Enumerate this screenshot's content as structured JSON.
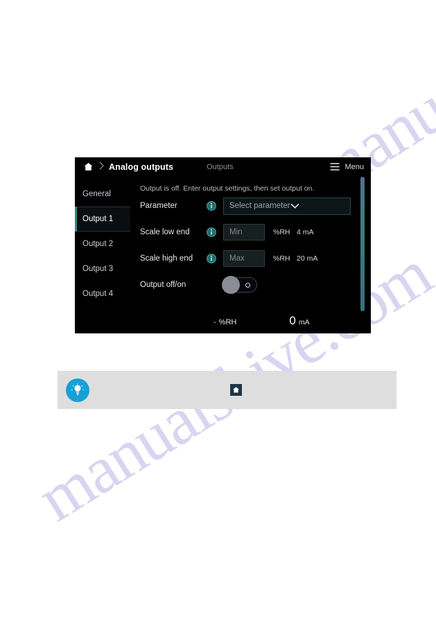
{
  "watermark": {
    "text_top": "manualshive.com",
    "text_bottom": "manualshive.com",
    "color": "#b9b4e6"
  },
  "device": {
    "header": {
      "home_icon": "home-icon",
      "separator_icon": "chevron-right-icon",
      "title": "Analog outputs",
      "subtitle": "Outputs",
      "menu_icon": "hamburger-icon",
      "menu_label": "Menu"
    },
    "sidebar": {
      "items": [
        {
          "label": "General",
          "active": false
        },
        {
          "label": "Output 1",
          "active": true
        },
        {
          "label": "Output 2",
          "active": false
        },
        {
          "label": "Output 3",
          "active": false
        },
        {
          "label": "Output 4",
          "active": false
        }
      ]
    },
    "content": {
      "status_message": "Output is off. Enter output settings, then set output on.",
      "rows": {
        "parameter": {
          "label": "Parameter",
          "info_icon": "info-icon",
          "select_value": "Select parameter",
          "chevron_icon": "chevron-down-icon"
        },
        "scale_low": {
          "label": "Scale low end",
          "info_icon": "info-icon",
          "input_placeholder": "Min",
          "unit": "%RH",
          "current": "4  mA"
        },
        "scale_high": {
          "label": "Scale high end",
          "info_icon": "info-icon",
          "input_placeholder": "Max",
          "unit": "%RH",
          "current": "20  mA"
        },
        "output_toggle": {
          "label": "Output off/on",
          "state": "off",
          "off_glyph_icon": "power-off-circle-icon"
        }
      },
      "footer": {
        "rh_dash": "-",
        "rh_unit": "%RH",
        "ma_value": "0",
        "ma_unit": "mA"
      }
    },
    "scrollbar": {
      "icon": "scrollbar-thumb",
      "accent_color": "#3d7e82"
    },
    "colors": {
      "background": "#000000",
      "accent_teal": "#2f8c8c",
      "text_primary": "#ffffff",
      "text_muted": "#8b8f97"
    }
  },
  "tip": {
    "bulb_icon": "lightbulb-icon",
    "text": "",
    "home_icon": "home-icon",
    "bulb_color": "#17a0d6",
    "box_color": "#dededf"
  }
}
